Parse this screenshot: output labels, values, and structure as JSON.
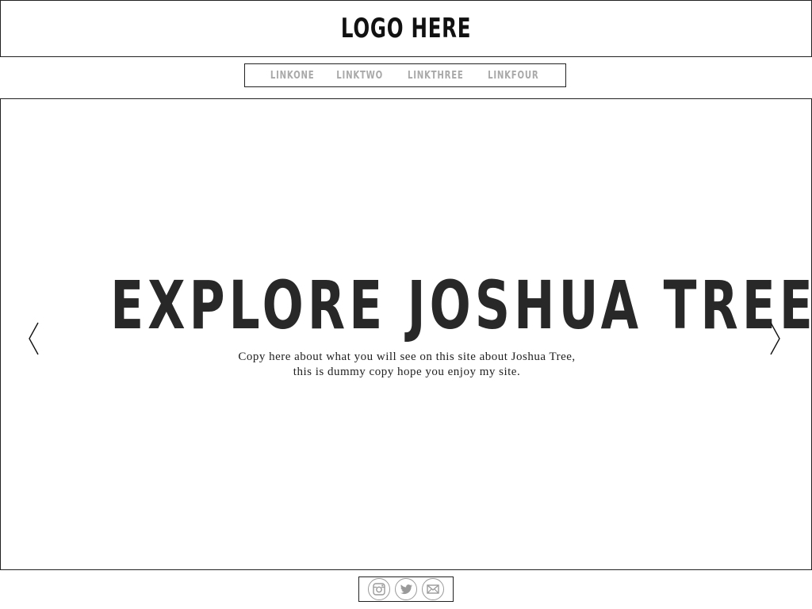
{
  "header": {
    "logo_text": "LOGO HERE"
  },
  "nav": {
    "links": [
      {
        "label": "LINKONE"
      },
      {
        "label": "LINKTWO"
      },
      {
        "label": "LINKTHREE"
      },
      {
        "label": "LINKFOUR"
      }
    ]
  },
  "hero": {
    "title": "EXPLORE JOSHUA TREE",
    "copy_line_1": "Copy here about what you will see on this site about Joshua Tree,",
    "copy_line_2": "this is dummy copy hope you enjoy my site.",
    "prev_icon": "chevron-left-icon",
    "next_icon": "chevron-right-icon"
  },
  "footer": {
    "social": [
      {
        "icon": "instagram-icon"
      },
      {
        "icon": "twitter-icon"
      },
      {
        "icon": "mail-icon"
      }
    ]
  },
  "colors": {
    "border": "#222222",
    "nav_link": "#a9a9a9",
    "title": "#282828",
    "social_icon": "#9a9a9a"
  }
}
